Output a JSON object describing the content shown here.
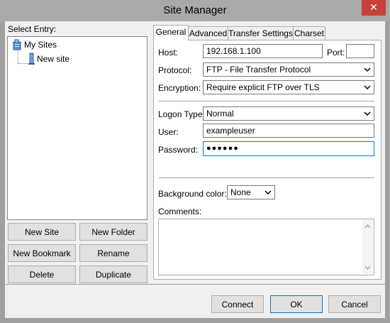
{
  "window": {
    "title": "Site Manager",
    "close_symbol": "✕"
  },
  "left": {
    "select_entry_label": "Select Entry:",
    "tree": [
      {
        "label": "My Sites",
        "icon": "folder-sites-icon"
      },
      {
        "label": "New site",
        "icon": "server-icon"
      }
    ],
    "buttons": {
      "new_site": "New Site",
      "new_folder": "New Folder",
      "new_bookmark": "New Bookmark",
      "rename": "Rename",
      "delete": "Delete",
      "duplicate": "Duplicate"
    }
  },
  "tabs": [
    {
      "label": "General",
      "active": true
    },
    {
      "label": "Advanced",
      "active": false
    },
    {
      "label": "Transfer Settings",
      "active": false
    },
    {
      "label": "Charset",
      "active": false
    }
  ],
  "general": {
    "host_label": "Host:",
    "host_value": "192.168.1.100",
    "port_label": "Port:",
    "port_value": "",
    "protocol_label": "Protocol:",
    "protocol_value": "FTP - File Transfer Protocol",
    "encryption_label": "Encryption:",
    "encryption_value": "Require explicit FTP over TLS",
    "logon_type_label": "Logon Type:",
    "logon_type_value": "Normal",
    "user_label": "User:",
    "user_value": "exampleuser",
    "password_label": "Password:",
    "password_value": "●●●●●●",
    "background_color_label": "Background color:",
    "background_color_value": "None",
    "comments_label": "Comments:",
    "comments_value": ""
  },
  "footer": {
    "connect": "Connect",
    "ok": "OK",
    "cancel": "Cancel"
  },
  "colors": {
    "close": "#c7403b",
    "focus": "#0078d7",
    "titlebar": "#a9a9a9",
    "client": "#f0f0f0"
  }
}
